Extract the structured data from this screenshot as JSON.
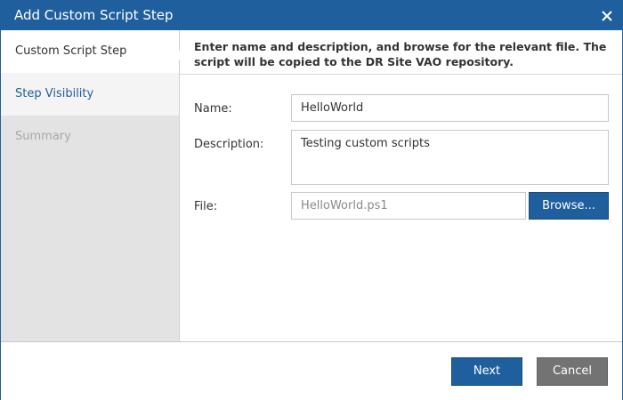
{
  "window": {
    "title": "Add Custom Script Step",
    "close_icon": "close-icon"
  },
  "steps": [
    {
      "label": "Custom Script Step",
      "state": "active"
    },
    {
      "label": "Step Visibility",
      "state": "link"
    },
    {
      "label": "Summary",
      "state": "disabled"
    }
  ],
  "header": {
    "line1": "Enter name and description, and browse for the relevant file. The",
    "line2": "script will be copied to the DR Site VAO repository."
  },
  "form": {
    "name_label": "Name:",
    "name_value": "HelloWorld",
    "description_label": "Description:",
    "description_value": "Testing custom scripts",
    "file_label": "File:",
    "file_value": "HelloWorld.ps1",
    "browse_label": "Browse..."
  },
  "footer": {
    "next_label": "Next",
    "cancel_label": "Cancel"
  },
  "colors": {
    "accent": "#1f5f9e",
    "secondary_button": "#737373",
    "sidebar": "#e3e3e3"
  }
}
